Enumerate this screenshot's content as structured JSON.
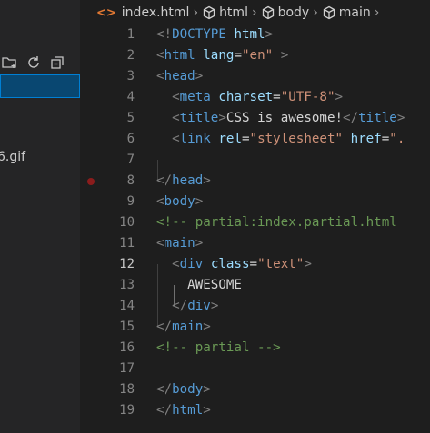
{
  "sidebar": {
    "file_label": "6.gif"
  },
  "breadcrumb": {
    "file": "index.html",
    "items": [
      "html",
      "body",
      "main"
    ]
  },
  "editor": {
    "line_numbers": [
      "1",
      "2",
      "3",
      "4",
      "5",
      "6",
      "7",
      "8",
      "9",
      "10",
      "11",
      "12",
      "13",
      "14",
      "15",
      "16",
      "17",
      "18",
      "19"
    ],
    "active_line": "12",
    "lines": [
      [
        [
          "tg",
          "<!"
        ],
        [
          "tn",
          "DOCTYPE"
        ],
        [
          "tx",
          " "
        ],
        [
          "at",
          "html"
        ],
        [
          "tg",
          ">"
        ]
      ],
      [
        [
          "tg",
          "<"
        ],
        [
          "tn",
          "html"
        ],
        [
          "tx",
          " "
        ],
        [
          "at",
          "lang"
        ],
        [
          "tx",
          "="
        ],
        [
          "st",
          "\"en\""
        ],
        [
          "tx",
          " "
        ],
        [
          "tg",
          ">"
        ]
      ],
      [
        [
          "tg",
          "<"
        ],
        [
          "tn",
          "head"
        ],
        [
          "tg",
          ">"
        ]
      ],
      [
        [
          "tx",
          "  "
        ],
        [
          "tg",
          "<"
        ],
        [
          "tn",
          "meta"
        ],
        [
          "tx",
          " "
        ],
        [
          "at",
          "charset"
        ],
        [
          "tx",
          "="
        ],
        [
          "st",
          "\"UTF-8\""
        ],
        [
          "tg",
          ">"
        ]
      ],
      [
        [
          "tx",
          "  "
        ],
        [
          "tg",
          "<"
        ],
        [
          "tn",
          "title"
        ],
        [
          "tg",
          ">"
        ],
        [
          "tx",
          "CSS is awesome!"
        ],
        [
          "tg",
          "</"
        ],
        [
          "tn",
          "title"
        ],
        [
          "tg",
          ">"
        ]
      ],
      [
        [
          "tx",
          "  "
        ],
        [
          "tg",
          "<"
        ],
        [
          "tn",
          "link"
        ],
        [
          "tx",
          " "
        ],
        [
          "at",
          "rel"
        ],
        [
          "tx",
          "="
        ],
        [
          "st",
          "\"stylesheet\""
        ],
        [
          "tx",
          " "
        ],
        [
          "at",
          "href"
        ],
        [
          "tx",
          "="
        ],
        [
          "st",
          "\"."
        ]
      ],
      [],
      [
        [
          "tg",
          "</"
        ],
        [
          "tn",
          "head"
        ],
        [
          "tg",
          ">"
        ]
      ],
      [
        [
          "tg",
          "<"
        ],
        [
          "tn",
          "body"
        ],
        [
          "tg",
          ">"
        ]
      ],
      [
        [
          "cm",
          "<!-- partial:index.partial.html"
        ]
      ],
      [
        [
          "tg",
          "<"
        ],
        [
          "tn",
          "main"
        ],
        [
          "tg",
          ">"
        ]
      ],
      [
        [
          "tx",
          "  "
        ],
        [
          "tg",
          "<"
        ],
        [
          "tn",
          "div"
        ],
        [
          "tx",
          " "
        ],
        [
          "at",
          "class"
        ],
        [
          "tx",
          "="
        ],
        [
          "st",
          "\"text\""
        ],
        [
          "tg",
          ">"
        ]
      ],
      [
        [
          "tx",
          "    AWESOME"
        ]
      ],
      [
        [
          "tx",
          "  "
        ],
        [
          "tg",
          "</"
        ],
        [
          "tn",
          "div"
        ],
        [
          "tg",
          ">"
        ]
      ],
      [
        [
          "tg",
          "</"
        ],
        [
          "tn",
          "main"
        ],
        [
          "tg",
          ">"
        ]
      ],
      [
        [
          "cm",
          "<!-- partial -->"
        ]
      ],
      [],
      [
        [
          "tg",
          "</"
        ],
        [
          "tn",
          "body"
        ],
        [
          "tg",
          ">"
        ]
      ],
      [
        [
          "tg",
          "</"
        ],
        [
          "tn",
          "html"
        ],
        [
          "tg",
          ">"
        ]
      ]
    ]
  }
}
